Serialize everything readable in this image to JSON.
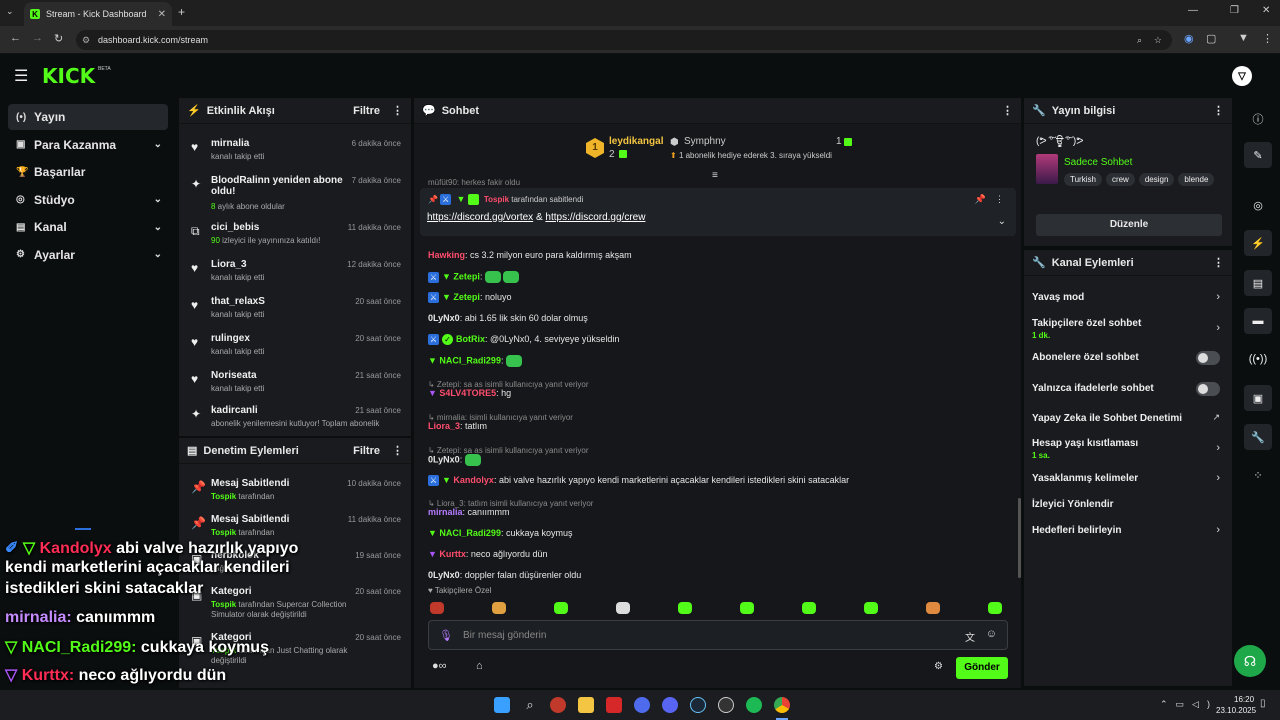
{
  "browser": {
    "tab_title": "Stream - Kick Dashboard",
    "url": "dashboard.kick.com/stream"
  },
  "header": {
    "logo": "KICK",
    "beta": "BETA"
  },
  "leftnav": [
    {
      "label": "Yayın",
      "icon": "broadcast-icon",
      "glyph": "(•)",
      "active": true,
      "chev": false
    },
    {
      "label": "Para Kazanma",
      "icon": "money-icon",
      "glyph": "▣",
      "active": false,
      "chev": true
    },
    {
      "label": "Başarılar",
      "icon": "trophy-icon",
      "glyph": "🏆",
      "active": false,
      "chev": false
    },
    {
      "label": "Stüdyo",
      "icon": "studio-icon",
      "glyph": "◎",
      "active": false,
      "chev": true
    },
    {
      "label": "Kanal",
      "icon": "channel-icon",
      "glyph": "▤",
      "active": false,
      "chev": true
    },
    {
      "label": "Ayarlar",
      "icon": "settings-icon",
      "glyph": "⚙",
      "active": false,
      "chev": true
    }
  ],
  "activity": {
    "title": "Etkinlik Akışı",
    "filter": "Filtre",
    "items": [
      {
        "glyph": "♥",
        "name": "mirnalia",
        "sub_strong": "",
        "sub": "kanalı takip etti",
        "time": "6 dakika önce"
      },
      {
        "glyph": "✦",
        "name": "BloodRalinn yeniden abone oldu!",
        "sub_strong": "8",
        "sub": " aylık abone oldular",
        "time": "7 dakika önce"
      },
      {
        "glyph": "⧉",
        "name": "cici_bebis",
        "sub_strong": "90",
        "sub": " izleyici ile yayınınıza katıldı!",
        "time": "11 dakika önce"
      },
      {
        "glyph": "♥",
        "name": "Liora_3",
        "sub_strong": "",
        "sub": "kanalı takip etti",
        "time": "12 dakika önce"
      },
      {
        "glyph": "♥",
        "name": "that_relaxS",
        "sub_strong": "",
        "sub": "kanalı takip etti",
        "time": "20 saat önce"
      },
      {
        "glyph": "♥",
        "name": "rulingex",
        "sub_strong": "",
        "sub": "kanalı takip etti",
        "time": "20 saat önce"
      },
      {
        "glyph": "♥",
        "name": "Noriseata",
        "sub_strong": "",
        "sub": "kanalı takip etti",
        "time": "21 saat önce"
      },
      {
        "glyph": "✦",
        "name": "kadircanli",
        "sub_strong": "",
        "sub": "abonelik yenilemesini kutluyor! Toplam abonelik",
        "time": "21 saat önce"
      }
    ]
  },
  "moderation": {
    "title": "Denetim Eylemleri",
    "filter": "Filtre",
    "items": [
      {
        "name": "Mesaj Sabitlendi",
        "by": "Tospik",
        "sub": " tarafından",
        "time": "10 dakika önce"
      },
      {
        "name": "Mesaj Sabitlendi",
        "by": "Tospik",
        "sub": " tarafından",
        "time": "11 dakika önce"
      },
      {
        "name": "herbkolok",
        "by": "",
        "sub": "sağlı kaldırıldı",
        "time": "19 saat önce"
      },
      {
        "name": "Kategori",
        "by": "Tospik",
        "sub": " tarafından Supercar Collection Simulator olarak değiştirildi",
        "time": "20 saat önce"
      },
      {
        "name": "Kategori",
        "by": "Tospik",
        "sub": " tarafından Just Chatting olarak değiştirildi",
        "time": "20 saat önce"
      }
    ]
  },
  "chat": {
    "title": "Sohbet",
    "leader1": {
      "name": "leydikangal",
      "count": "2"
    },
    "leader2": {
      "name": "Symphny",
      "count": "1",
      "note": "1 abonelik hediye ederek 3. sıraya yükseldi"
    },
    "cut_line": "müfüt90: herkes fakir oldu",
    "pinned": {
      "by": "Tospik",
      "by_suffix": " tarafından sabitlendi",
      "link1": "https://discord.gg/vortex",
      "amp": " & ",
      "link2": "https://discord.gg/crew"
    },
    "messages": [
      {
        "kind": "msg",
        "user": "Hawking",
        "color": "#ff4d6d",
        "text": ": cs 3.2 milyon euro para kaldırmış akşam"
      },
      {
        "kind": "msg",
        "user": "Zetepi",
        "color": "#53fc18",
        "text": ": ",
        "emotes": 2,
        "badges": [
          "blue",
          "tri"
        ]
      },
      {
        "kind": "msg",
        "user": "Zetepi",
        "color": "#53fc18",
        "text": ": noluyo",
        "badges": [
          "blue",
          "tri"
        ]
      },
      {
        "kind": "msg",
        "user": "0LyNx0",
        "color": "#e6e6e6",
        "text": ": abi 1.65 lik skin 60 dolar olmuş"
      },
      {
        "kind": "msg",
        "user": "BotRix",
        "color": "#53fc18",
        "text": ": @0LyNx0, 4. seviyeye yükseldin",
        "badges": [
          "blue",
          "check"
        ]
      },
      {
        "kind": "msg",
        "user": "NACI_Radi299",
        "color": "#53fc18",
        "text": ": ",
        "emotes": 1,
        "badges": [
          "tri"
        ]
      },
      {
        "kind": "reply",
        "text": "↳ Zetepi: sa as isimli kullanıcıya yanıt veriyor"
      },
      {
        "kind": "msg",
        "user": "S4LV4TORE5",
        "color": "#ff4d6d",
        "text": ": hg",
        "badges": [
          "trip"
        ]
      },
      {
        "kind": "reply",
        "text": "↳ mirnalia: isimli kullanıcıya yanıt veriyor"
      },
      {
        "kind": "msg",
        "user": "Liora_3",
        "color": "#ff4d6d",
        "text": ": tatlım"
      },
      {
        "kind": "reply",
        "text": "↳ Zetepi: sa as isimli kullanıcıya yanıt veriyor"
      },
      {
        "kind": "msg",
        "user": "0LyNx0",
        "color": "#e6e6e6",
        "text": ": ",
        "emotes": 1
      },
      {
        "kind": "msg",
        "user": "Kandolyx",
        "color": "#ff4d6d",
        "text": ": abi valve hazırlık yapıyo kendi marketlerini açacaklar kendileri istedikleri skini satacaklar",
        "badges": [
          "blue",
          "tri"
        ]
      },
      {
        "kind": "reply",
        "text": "↳ Liora_3: tatlım isimli kullanıcıya yanıt veriyor"
      },
      {
        "kind": "msg",
        "user": "mirnalia",
        "color": "#b57bff",
        "text": ": canıımmm"
      },
      {
        "kind": "msg",
        "user": "NACI_Radi299",
        "color": "#53fc18",
        "text": ": cukkaya koymuş",
        "badges": [
          "tri"
        ]
      },
      {
        "kind": "msg",
        "user": "Kurttx",
        "color": "#ff4d6d",
        "text": ": neco ağlıyordu dün",
        "badges": [
          "trip"
        ]
      },
      {
        "kind": "msg",
        "user": "0LyNx0",
        "color": "#e6e6e6",
        "text": ": doppler falan düşürenler oldu"
      }
    ],
    "followers_only": "Takipçilere Özel",
    "input_placeholder": "Bir mesaj gönderin",
    "send": "Gönder"
  },
  "info": {
    "title": "Yayın bilgisi",
    "stream_title": "(ᕗ ͠° ਊ ͠° )ᕗ",
    "category": "Sadece Sohbet",
    "tags": [
      "Turkish",
      "crew",
      "design",
      "blende"
    ],
    "edit": "Düzenle"
  },
  "actions": {
    "title": "Kanal Eylemleri",
    "items": [
      {
        "label": "Yavaş mod",
        "sub": "",
        "ctrl": "chev"
      },
      {
        "label": "Takipçilere özel sohbet",
        "sub": "1 dk.",
        "ctrl": "chev"
      },
      {
        "label": "Abonelere özel sohbet",
        "sub": "",
        "ctrl": "toggle"
      },
      {
        "label": "Yalnızca ifadelerle sohbet",
        "sub": "",
        "ctrl": "toggle"
      },
      {
        "label": "Yapay Zeka ile Sohbet Denetimi",
        "sub": "",
        "ctrl": "ext"
      },
      {
        "label": "Hesap yaşı kısıtlaması",
        "sub": "1 sa.",
        "ctrl": "chev"
      },
      {
        "label": "Yasaklanmış kelimeler",
        "sub": "",
        "ctrl": "chev"
      },
      {
        "label": "İzleyici Yönlendir",
        "sub": "",
        "ctrl": "none"
      },
      {
        "label": "Hedefleri belirleyin",
        "sub": "",
        "ctrl": "chev"
      }
    ]
  },
  "overlay": [
    {
      "user": "Kandolyx",
      "color": "#ff2d55",
      "text": " abi valve hazırlık yapıyo"
    },
    {
      "user": "",
      "color": "",
      "text": "kendi marketlerini açacaklar kendileri"
    },
    {
      "user": "",
      "color": "",
      "text": "istedikleri skini satacaklar"
    },
    {
      "user": "mirnalia:",
      "color": "#c58cff",
      "text": " canıımmm"
    },
    {
      "user": "NACI_Radi299:",
      "color": "#53fc18",
      "text": " cukkaya koymuş"
    },
    {
      "user": "Kurttx:",
      "color": "#ff2d55",
      "text": " neco ağlıyordu dün"
    },
    {
      "user": "0LyNx0:",
      "color": "#ffffff",
      "text": " doppler falan düşürenler oldu"
    }
  ],
  "taskbar": {
    "time": "16:20",
    "date": "23.10.2025"
  }
}
